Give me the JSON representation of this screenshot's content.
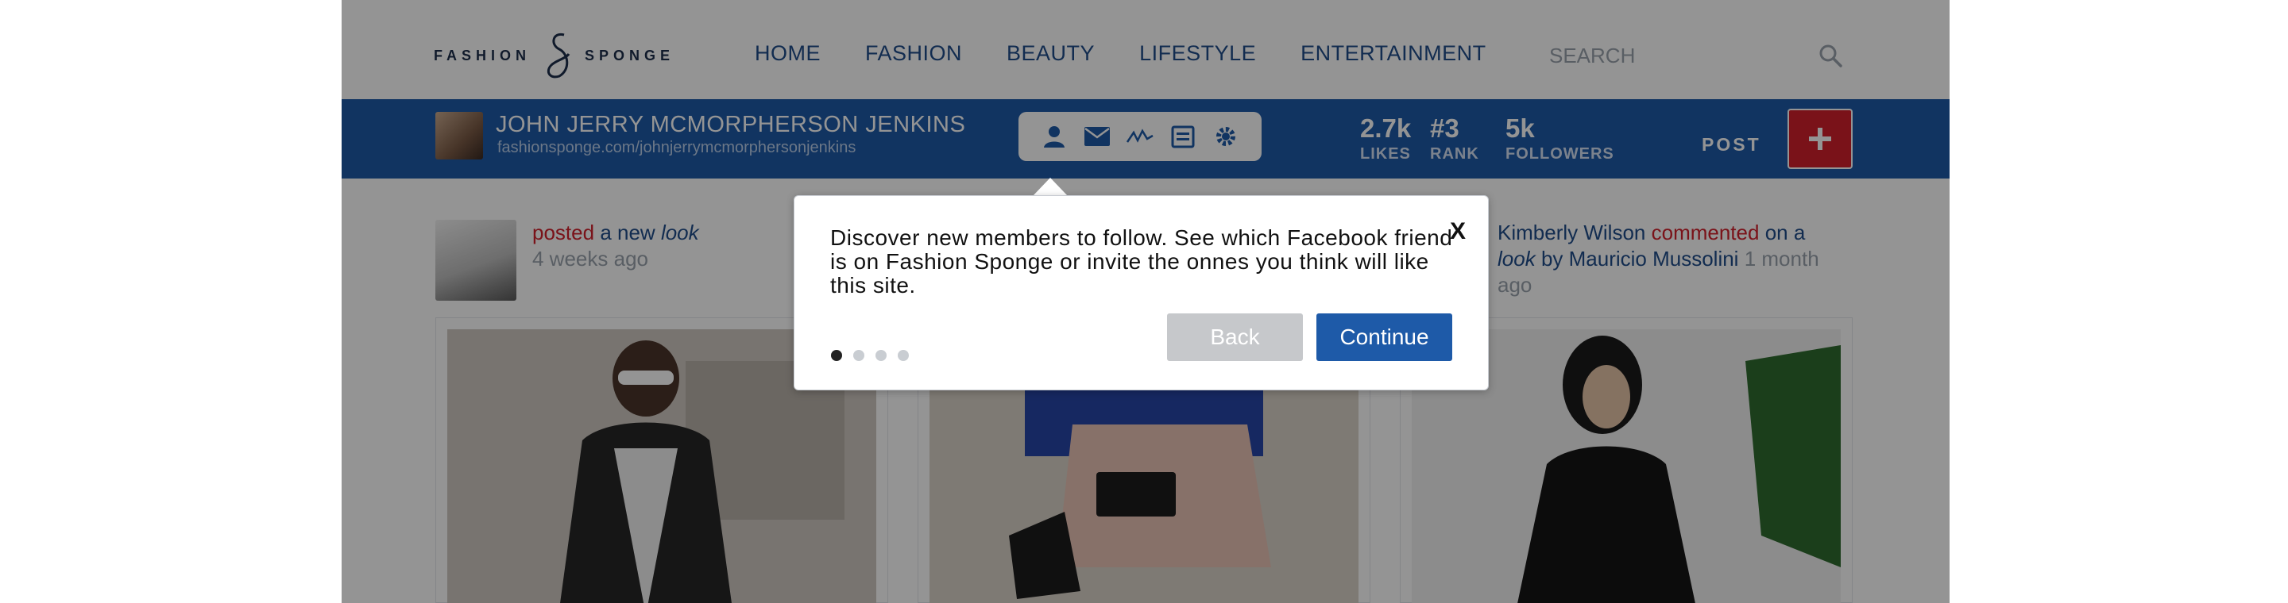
{
  "logo": {
    "left_word": "FASHION",
    "right_word": "SPONGE"
  },
  "nav": {
    "items": [
      "HOME",
      "FASHION",
      "BEAUTY",
      "LIFESTYLE",
      "ENTERTAINMENT"
    ]
  },
  "search": {
    "placeholder": "SEARCH",
    "icon": "search-icon"
  },
  "profile": {
    "name": "JOHN JERRY MCMORPHERSON JENKINS",
    "url": "fashionsponge.com/johnjerrymcmorphersonjenkins",
    "toolbar_icons": [
      "user-icon",
      "mail-icon",
      "activity-icon",
      "calendar-icon",
      "gear-icon"
    ],
    "stats": [
      {
        "value": "2.7k",
        "label": "LIKES"
      },
      {
        "value": "#3",
        "label": "RANK"
      },
      {
        "value": "5k",
        "label": "FOLLOWERS"
      }
    ],
    "post_label": "POST",
    "post_button_symbol": "+"
  },
  "feed": {
    "left_activity": {
      "action": "posted",
      "text": "a new",
      "object": "look",
      "time": "4 weeks ago"
    },
    "right_activity": {
      "user": "Kimberly Wilson",
      "action": "commented",
      "on": "on a",
      "object": "look",
      "by": "by Mauricio Mussolini",
      "time": "1 month",
      "time2": "ago"
    }
  },
  "tooltip": {
    "text": "Discover new members to follow. See which Facebook friend is on Fashion Sponge or invite the onnes you think will like this site.",
    "close_label": "X",
    "back_label": "Back",
    "continue_label": "Continue",
    "steps_total": 4,
    "current_step": 1
  },
  "colors": {
    "brand_blue": "#1e5aa8",
    "accent_red": "#d3202c",
    "overlay": "rgba(0,0,0,0.42)"
  }
}
